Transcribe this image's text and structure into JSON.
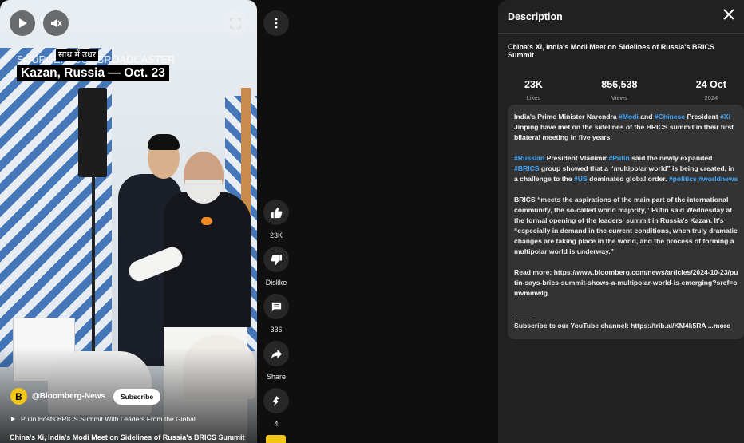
{
  "video": {
    "source_text": "SOURCE: HOST BROADCASTER",
    "hindi_caption": "साथ में उधर",
    "location_text": "Kazan, Russia — Oct. 23",
    "channel": {
      "avatar_letter": "B",
      "handle": "@Bloomberg-News",
      "subscribe_label": "Subscribe"
    },
    "playlist_text": "Putin Hosts BRICS Summit With Leaders From the Global",
    "title": "China's Xi, India's Modi Meet on Sidelines of Russia's BRICS Summit"
  },
  "actions": {
    "like_count": "23K",
    "dislike_label": "Dislike",
    "comment_count": "336",
    "share_label": "Share",
    "remix_count": "4"
  },
  "description_panel": {
    "heading": "Description",
    "video_title": "China's Xi, India's Modi Meet on Sidelines of Russia's BRICS Summit",
    "stats": [
      {
        "value": "23K",
        "label": "Likes"
      },
      {
        "value": "856,538",
        "label": "Views"
      },
      {
        "value": "24 Oct",
        "label": "2024"
      }
    ],
    "para1": {
      "t1": "India's Prime Minister Narendra ",
      "tag1": "#Modi",
      "t2": " and ",
      "tag2": "#Chinese",
      "t3": " President ",
      "tag3": "#Xi",
      "t4": " Jinping have met on the sidelines of the BRICS summit in their first bilateral meeting in five years."
    },
    "para2": {
      "tag1": "#Russian",
      "t1": " President Vladimir ",
      "tag2": "#Putin",
      "t2": " said the newly expanded ",
      "tag3": "#BRICS",
      "t3": " group showed that a “multipolar world” is being created, in a challenge to the ",
      "tag4": "#US",
      "t4": " dominated global order. ",
      "tag5": "#politics",
      "t5": " ",
      "tag6": "#worldnews"
    },
    "para3": "BRICS “meets the aspirations of the main part of the international community, the so-called world majority,” Putin said Wednesday at the formal opening of the leaders' summit in Russia's Kazan. It's “especially in demand in the current conditions, when truly dramatic changes are taking place in the world, and the process of forming a multipolar world is underway.”",
    "para4": "Read more: https://www.bloomberg.com/news/articles/2024-10-23/putin-says-brics-summit-shows-a-multipolar-world-is-emerging?sref=omvmmwlg",
    "separator": "———",
    "subscribe_line": "Subscribe to our YouTube channel: https://trib.al/KM4k5RA",
    "more_label": "...more"
  },
  "icons": [
    "play-icon",
    "mute-icon",
    "fullscreen-icon",
    "more-vert-icon",
    "thumb-up-icon",
    "thumb-down-icon",
    "comment-icon",
    "share-icon",
    "remix-icon",
    "close-icon"
  ]
}
